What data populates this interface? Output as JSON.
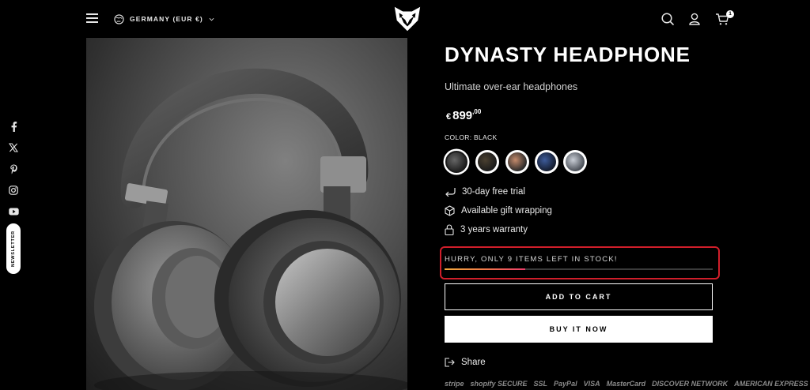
{
  "header": {
    "locale_label": "GERMANY (EUR €)",
    "cart_count": "1"
  },
  "sidebar": {
    "social": [
      "facebook-icon",
      "x-icon",
      "pinterest-icon",
      "instagram-icon",
      "youtube-icon"
    ],
    "newsletter_label": "NEWSLETTER"
  },
  "product": {
    "title": "DYNASTY HEADPHONE",
    "subtitle": "Ultimate over-ear headphones",
    "price": {
      "currency": "€",
      "amount": "899",
      "cents": ",00"
    },
    "color_label": "COLOR: BLACK",
    "swatches": [
      "black",
      "black-gold",
      "silver-rose",
      "navy",
      "silver-blue"
    ],
    "features": [
      "30-day free trial",
      "Available gift wrapping",
      "3 years warranty"
    ],
    "stock": {
      "message": "HURRY, ONLY 9 ITEMS LEFT IN STOCK!",
      "level_fraction": 0.3
    },
    "add_to_cart_label": "ADD TO CART",
    "buy_now_label": "BUY IT NOW",
    "share_label": "Share",
    "payment_badges": [
      "stripe",
      "shopify SECURE",
      "SSL",
      "PayPal",
      "VISA",
      "MasterCard",
      "DISCOVER NETWORK",
      "AMERICAN EXPRESS"
    ]
  },
  "colors": {
    "background": "#000000",
    "accent_red": "#d01e2a",
    "stock_gradient_start": "#f2a93b",
    "stock_gradient_end": "#ec3d6a"
  }
}
